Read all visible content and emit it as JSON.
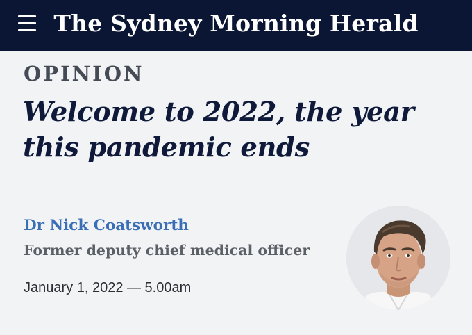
{
  "header": {
    "menu_icon": "hamburger-menu-icon",
    "masthead": "The Sydney Morning Herald",
    "background": "#0a1633"
  },
  "article": {
    "section": "OPINION",
    "headline": "Welcome to 2022, the year this pandemic ends",
    "author": {
      "name": "Dr Nick Coatsworth",
      "role": "Former deputy chief medical officer",
      "name_color": "#3a6fb5"
    },
    "published": "January 1, 2022 — 5.00am"
  }
}
